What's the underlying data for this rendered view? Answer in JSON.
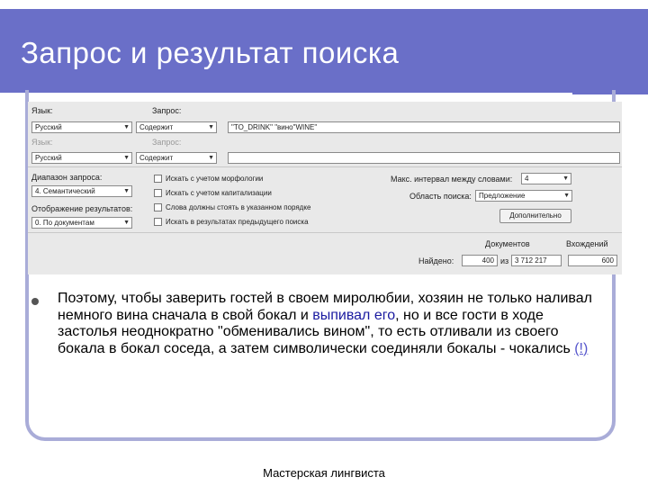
{
  "slide": {
    "title": "Запрос и результат поиска",
    "footer": "Мастерская лингвиста"
  },
  "form": {
    "lang_label_1": "Язык:",
    "query_label_1": "Запрос:",
    "lang_value_1": "Русский",
    "query_type_1": "Содержит",
    "query_text_1": "\"TO_DRINK\" \"вино\"WINE\"",
    "lang_label_2": "Язык:",
    "query_label_2": "Запрос:",
    "lang_value_2": "Русский",
    "query_type_2": "Содержит",
    "query_text_2": "",
    "range_label": "Диапазон запроса:",
    "range_value": "4. Семантический",
    "display_label": "Отображение результатов:",
    "display_value": "0. По документам",
    "check_morph": "Искать с учетом морфологии",
    "check_caps": "Искать с учетом капитализации",
    "check_order": "Слова должны стоять в указанном порядке",
    "check_prev": "Искать в результатах предыдущего поиска",
    "max_interval_label": "Макс. интервал между словами:",
    "max_interval_value": "4",
    "search_area_label": "Область поиска:",
    "search_area_value": "Предложение",
    "extra_button": "Дополнительно",
    "col_docs": "Документов",
    "col_occ": "Вхождений",
    "found_label": "Найдено:",
    "found_docs": "400",
    "found_of": "из",
    "found_total": "3 712 217",
    "found_occ": "600"
  },
  "bullet": {
    "part1": "Поэтому, чтобы заверить гостей в своем миролюбии, хозяин не только наливал немного вина сначала в свой бокал и ",
    "highlight": "выпивал его",
    "part2": ", но и все гости в ходе застолья неоднократно \"обменивались вином\", то есть отливали из своего бокала в бокал соседа, а затем символически соединяли бокалы - чокались ",
    "link": "(!)"
  },
  "colors": {
    "title_bg": "#6a6fc8",
    "frame": "#a9acd8",
    "panel_bg": "#e9e9e9"
  }
}
